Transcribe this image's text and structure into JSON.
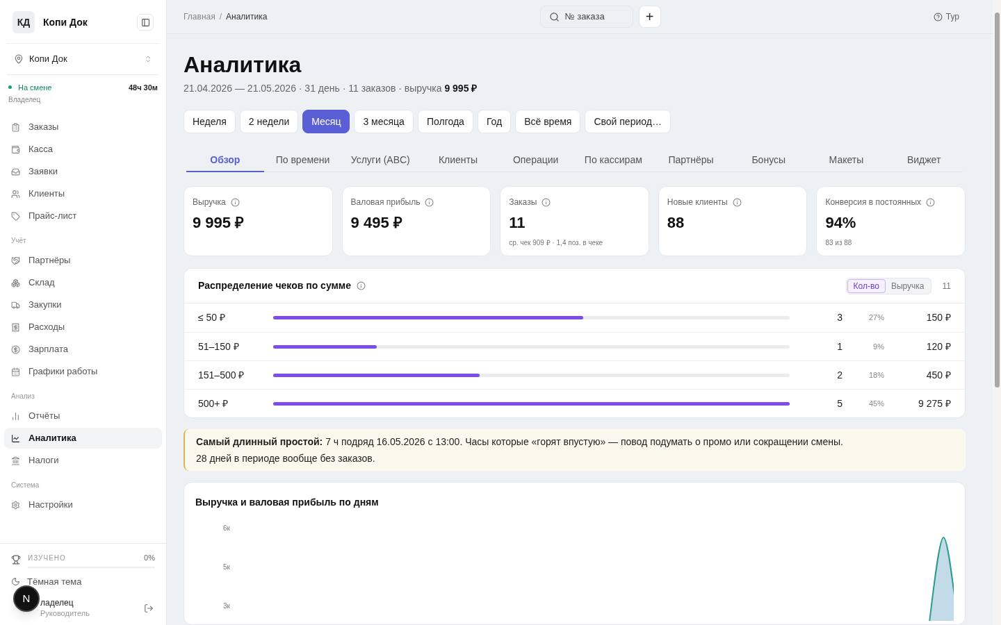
{
  "sidebar": {
    "brand": {
      "initials": "КД",
      "name": "Копи Док"
    },
    "location": "Копи Док",
    "shift": {
      "status": "На смене",
      "on": true,
      "duration": "48ч 30м",
      "role": "Владелец"
    },
    "sections": [
      {
        "items": [
          {
            "label": "Заказы",
            "selected": false
          },
          {
            "label": "Касса",
            "selected": false
          },
          {
            "label": "Заявки",
            "selected": false
          },
          {
            "label": "Клиенты",
            "selected": false
          },
          {
            "label": "Прайс-лист",
            "selected": false
          }
        ]
      },
      {
        "title": "Учёт",
        "items": [
          {
            "label": "Партнёры",
            "selected": false
          },
          {
            "label": "Склад",
            "selected": false
          },
          {
            "label": "Закупки",
            "selected": false
          },
          {
            "label": "Расходы",
            "selected": false
          },
          {
            "label": "Зарплата",
            "selected": false
          },
          {
            "label": "Графики работы",
            "selected": false
          }
        ]
      },
      {
        "title": "Анализ",
        "items": [
          {
            "label": "Отчёты",
            "selected": false
          },
          {
            "label": "Аналитика",
            "selected": true
          }
        ]
      },
      {
        "items": [
          {
            "label": "Налоги",
            "selected": false
          }
        ]
      },
      {
        "title": "Система",
        "items": [
          {
            "label": "Настройки",
            "selected": false
          }
        ]
      }
    ],
    "progress": {
      "label": "ИЗУЧЕНО",
      "value": "0%"
    },
    "theme_toggle": "Тёмная тема",
    "user": {
      "name": "ладелец",
      "role": "Руководитель"
    },
    "dev_badge": "N"
  },
  "breadcrumb": [
    "Главная",
    "/",
    "Аналитика"
  ],
  "search": {
    "placeholder": "№ заказа"
  },
  "add_button": "+",
  "tour_button": "Тур",
  "title": "Аналитика",
  "subtitle": "21.04.2026 — 21.05.2026 · 31 день · 11 заказов · выручка **9 995 ₽**",
  "periods": [
    {
      "label": "Неделя",
      "selected": false
    },
    {
      "label": "2 недели",
      "selected": false
    },
    {
      "label": "Месяц",
      "selected": true
    },
    {
      "label": "3 месяца",
      "selected": false
    },
    {
      "label": "Полгода",
      "selected": false
    },
    {
      "label": "Год",
      "selected": false
    },
    {
      "label": "Всё время",
      "selected": false
    },
    {
      "label": "Свой период…",
      "selected": false
    }
  ],
  "tabs": [
    {
      "label": "Обзор",
      "selected": true
    },
    {
      "label": "По времени",
      "selected": false
    },
    {
      "label": "Услуги (ABC)",
      "selected": false
    },
    {
      "label": "Клиенты",
      "selected": false
    },
    {
      "label": "Операции",
      "selected": false
    },
    {
      "label": "По кассирам",
      "selected": false
    },
    {
      "label": "Партнёры",
      "selected": false
    },
    {
      "label": "Бонусы",
      "selected": false
    },
    {
      "label": "Макеты",
      "selected": false
    },
    {
      "label": "Виджет",
      "selected": false
    }
  ],
  "kpis": [
    {
      "label": "Выручка",
      "value": "9 995 ₽"
    },
    {
      "label": "Валовая прибыль",
      "value": "9 495 ₽"
    },
    {
      "label": "Заказы",
      "value": "11",
      "note": "ср. чек 909 ₽ · 1,4 поз. в чеке"
    },
    {
      "label": "Новые клиенты",
      "value": "88"
    },
    {
      "label": "Конверсия в постоянных",
      "value": "94%",
      "note": "83 из 88"
    }
  ],
  "distribution": {
    "title": "Распределение чеков по сумме",
    "modes": [
      {
        "label": "Кол-во",
        "selected": true
      },
      {
        "label": "Выручка",
        "selected": false
      }
    ],
    "total": "11",
    "rows": [
      {
        "range": "≤ 50 ₽",
        "level": 0.6,
        "count": "3",
        "share": "27%",
        "amount": "150 ₽"
      },
      {
        "range": "51–150 ₽",
        "level": 0.2,
        "count": "1",
        "share": "9%",
        "amount": "120 ₽"
      },
      {
        "range": "151–500 ₽",
        "level": 0.4,
        "count": "2",
        "share": "18%",
        "amount": "450 ₽"
      },
      {
        "range": "500+ ₽",
        "level": 1,
        "count": "5",
        "share": "45%",
        "amount": "9 275 ₽"
      }
    ]
  },
  "notice": {
    "lines": [
      "**Самый длинный простой:** 7 ч подряд 16.05.2026 с 13:00. Часы которые «горят впустую» — повод подумать о промо или сокращении смены.",
      "28 дней в периоде вообще без заказов."
    ]
  },
  "daily_chart": {
    "title": "Выручка и валовая прибыль по дням",
    "y_labels": [
      "6к",
      "5к",
      "3к"
    ]
  }
}
